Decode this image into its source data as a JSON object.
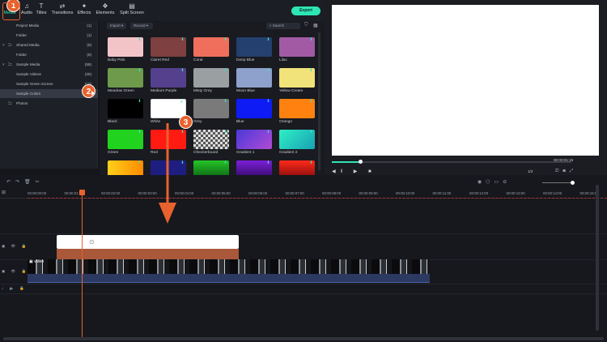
{
  "tabs": [
    {
      "label": "Media",
      "icon": "folder-icon"
    },
    {
      "label": "Audio",
      "icon": "music-note-icon"
    },
    {
      "label": "Titles",
      "icon": "text-icon"
    },
    {
      "label": "Transitions",
      "icon": "transitions-icon"
    },
    {
      "label": "Effects",
      "icon": "effects-icon"
    },
    {
      "label": "Elements",
      "icon": "elements-icon"
    },
    {
      "label": "Split Screen",
      "icon": "split-screen-icon"
    }
  ],
  "export_label": "Export",
  "tree": [
    {
      "label": "Project Media",
      "count": "(1)"
    },
    {
      "label": "Folder",
      "count": "(1)"
    },
    {
      "label": "Shared Media",
      "count": "(0)"
    },
    {
      "label": "Folder",
      "count": "(0)"
    },
    {
      "label": "Sample Media",
      "count": "(55)"
    },
    {
      "label": "Sample Videos",
      "count": "(20)"
    },
    {
      "label": "Sample Green Screen",
      "count": "(10)"
    },
    {
      "label": "Sample Colors",
      "count": "(25)"
    },
    {
      "label": "Photos",
      "count": ""
    }
  ],
  "grid_toolbar": {
    "import": "Import",
    "record": "Record",
    "search_placeholder": "Search"
  },
  "colors": [
    {
      "name": "Baby Pink",
      "color": "#f2c4c8"
    },
    {
      "name": "Claret Red",
      "color": "#7e4040"
    },
    {
      "name": "Coral",
      "color": "#ef6f5c"
    },
    {
      "name": "Deep Blue",
      "color": "#24406e"
    },
    {
      "name": "Lilac",
      "color": "#a25aa5"
    },
    {
      "name": "Meadow Green",
      "color": "#6e9a4c"
    },
    {
      "name": "Medium Purple",
      "color": "#55408d"
    },
    {
      "name": "Misty Grey",
      "color": "#9aa0a2"
    },
    {
      "name": "Moon Blue",
      "color": "#8ea0cc"
    },
    {
      "name": "Yellow Cream",
      "color": "#f1e27a"
    },
    {
      "name": "Black",
      "color": "#000000"
    },
    {
      "name": "White",
      "color": "#ffffff"
    },
    {
      "name": "Grey",
      "color": "#7a7a7a"
    },
    {
      "name": "Blue",
      "color": "#0f1bf4"
    },
    {
      "name": "Orange",
      "color": "#ff8210"
    },
    {
      "name": "Green",
      "color": "#21d31e"
    },
    {
      "name": "Red",
      "color": "#ff1a12"
    },
    {
      "name": "Checkerboard",
      "color": "checker"
    },
    {
      "name": "Gradient 1",
      "color": "grad1"
    },
    {
      "name": "Gradient 2",
      "color": "grad2"
    },
    {
      "name": "",
      "color": "grad3"
    },
    {
      "name": "",
      "color": "#1e1e80"
    },
    {
      "name": "",
      "color": "grad4"
    },
    {
      "name": "",
      "color": "grad5"
    },
    {
      "name": "",
      "color": "grad6"
    }
  ],
  "preview": {
    "time": "00:00:01:15",
    "quality": "1/2"
  },
  "ruler": [
    "00:00:00:00",
    "00:00:01:00",
    "00:00:02:00",
    "00:00:03:00",
    "00:00:04:00",
    "00:00:05:00",
    "00:00:06:00",
    "00:00:07:00",
    "00:00:08:00",
    "00:00:09:00",
    "00:00:10:00",
    "00:00:11:00",
    "00:00:12:00",
    "00:00:13:00",
    "00:00:14:00",
    "00:00:15:00"
  ],
  "video_clip_label": "video",
  "steps": [
    "1",
    "2",
    "3"
  ]
}
